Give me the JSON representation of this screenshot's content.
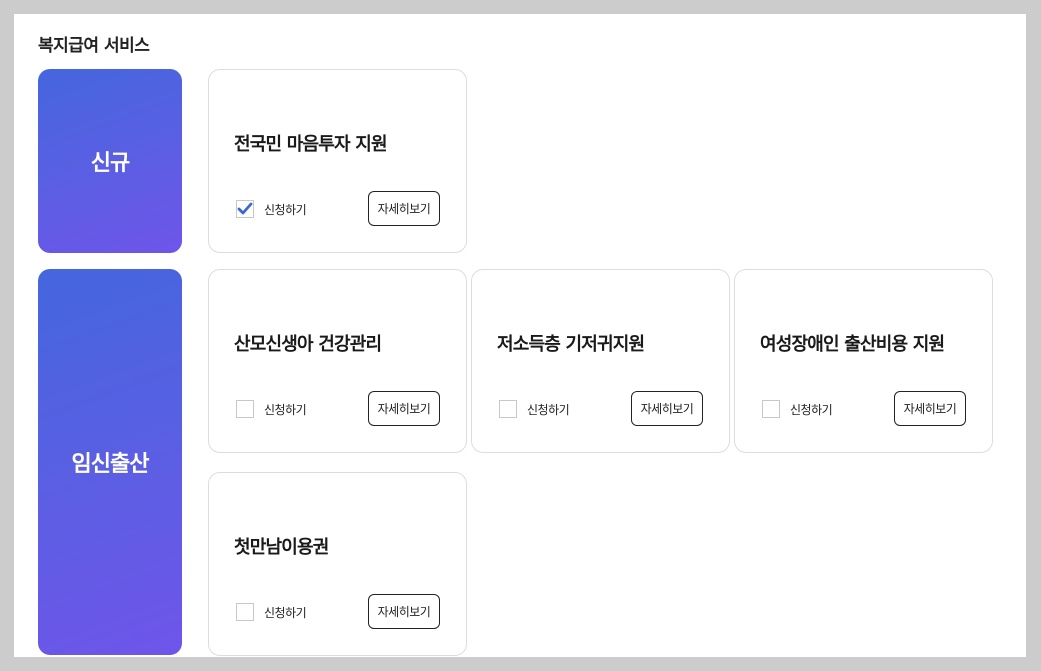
{
  "page": {
    "title": "복지급여 서비스"
  },
  "categories": [
    {
      "label": "신규",
      "services": [
        {
          "title": "전국민 마음투자 지원",
          "apply_label": "신청하기",
          "checked": true,
          "detail_label": "자세히보기"
        }
      ]
    },
    {
      "label": "임신출산",
      "services": [
        {
          "title": "산모신생아 건강관리",
          "apply_label": "신청하기",
          "checked": false,
          "detail_label": "자세히보기"
        },
        {
          "title": "저소득층 기저귀지원",
          "apply_label": "신청하기",
          "checked": false,
          "detail_label": "자세히보기"
        },
        {
          "title": "여성장애인 출산비용 지원",
          "apply_label": "신청하기",
          "checked": false,
          "detail_label": "자세히보기"
        },
        {
          "title": "첫만남이용권",
          "apply_label": "신청하기",
          "checked": false,
          "detail_label": "자세히보기"
        }
      ]
    }
  ],
  "colors": {
    "background": "#cccccc",
    "category_gradient_start": "#4466dd",
    "category_gradient_end": "#6f55ea",
    "checkmark": "#3b66d9"
  }
}
